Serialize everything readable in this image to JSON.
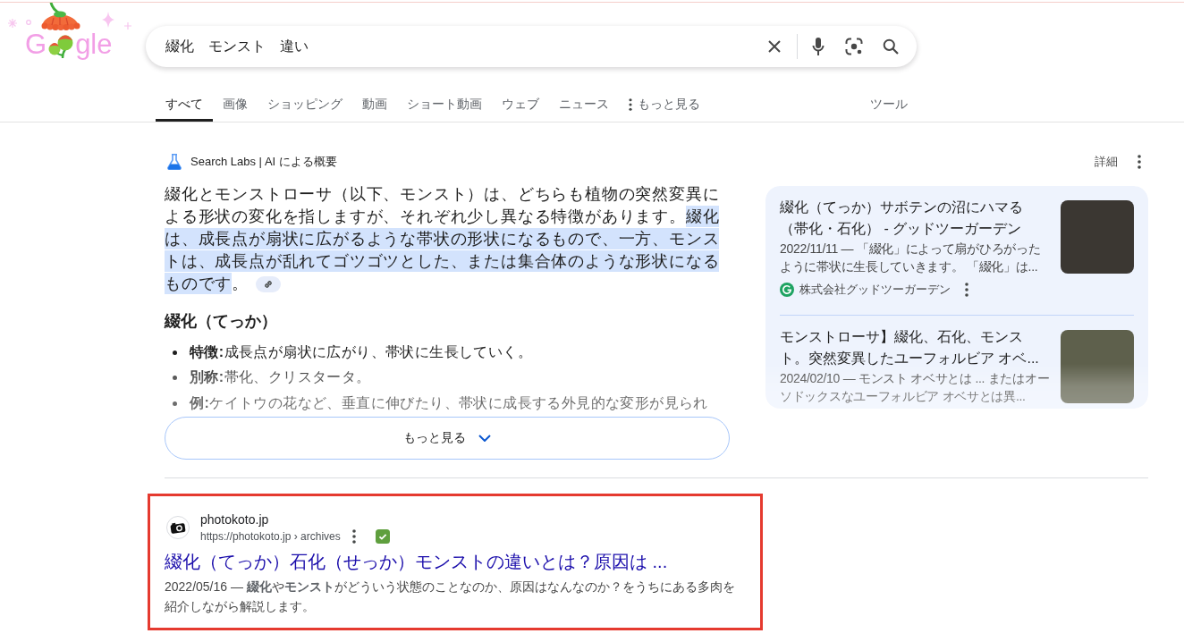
{
  "logo": {
    "text_start": "G",
    "text_end": "gle"
  },
  "search": {
    "query": "綴化　モンスト　違い"
  },
  "tabs": [
    {
      "label": "すべて",
      "kind": "tab",
      "selected": true
    },
    {
      "label": "画像",
      "kind": "tab",
      "selected": false
    },
    {
      "label": "ショッピング",
      "kind": "tab",
      "selected": false
    },
    {
      "label": "動画",
      "kind": "tab",
      "selected": false
    },
    {
      "label": "ショート動画",
      "kind": "tab",
      "selected": false
    },
    {
      "label": "ウェブ",
      "kind": "tab",
      "selected": false
    },
    {
      "label": "ニュース",
      "kind": "tab",
      "selected": false
    },
    {
      "label": "もっと見る",
      "kind": "menu",
      "selected": false
    }
  ],
  "tools": {
    "label": "ツール"
  },
  "ai_overview": {
    "header": "Search Labs | AI による概要",
    "details_label": "詳細",
    "summary": [
      {
        "text": "綴化とモンストローサ（以下、モンスト）は、どちらも植物の突然変異による形状の変化を指しますが、それぞれ少し異なる特徴があります。",
        "highlighted": false
      },
      {
        "text": "綴化は、成長点が扇状に広がるような帯状の形状になるもので、一方、モンストは、成長点が乱れてゴツゴツとした、または集合体のような形状になるものです",
        "highlighted": true
      },
      {
        "text": "。",
        "highlighted": false
      }
    ],
    "section_title": "綴化（てっか）",
    "bullets": [
      "**特徴:**成長点が扇状に広がり、帯状に生長していく。",
      "**別称:**帯化、クリスタータ。",
      "**例:**ケイトウの花など、垂直に伸びたり、帯状に成長する外見的な変形が見られ"
    ],
    "more_button": "もっと見る",
    "sources": [
      {
        "title": "綴化（てっか）サボテンの沼にハマる（帯化・石化） - グッドツーガーデン",
        "snippet": "2022/11/11 — 「綴化」によって扇がひろがったように帯状に生長していきます。 「綴化」は...",
        "site": "株式会社グッドツーガーデン"
      },
      {
        "title": "モンストローサ】綴化、石化、モンスト。突然変異したユーフォルビア オベ...",
        "snippet": "2024/02/10 — モンスト オベサとは ... またはオーソドックスなユーフォルビア オベサとは異..."
      }
    ]
  },
  "results": [
    {
      "site_name": "photokoto.jp",
      "url": "https://photokoto.jp › archives",
      "verified": true,
      "title": "綴化（てっか）石化（せっか）モンストの違いとは？原因は ...",
      "snippet": "2022/05/16 — **綴化**や**モンスト**がどういう状態のことなのか、原因はなんなのか？をうちにある多肉を紹介しながら解説します。",
      "outlined": true
    }
  ]
}
